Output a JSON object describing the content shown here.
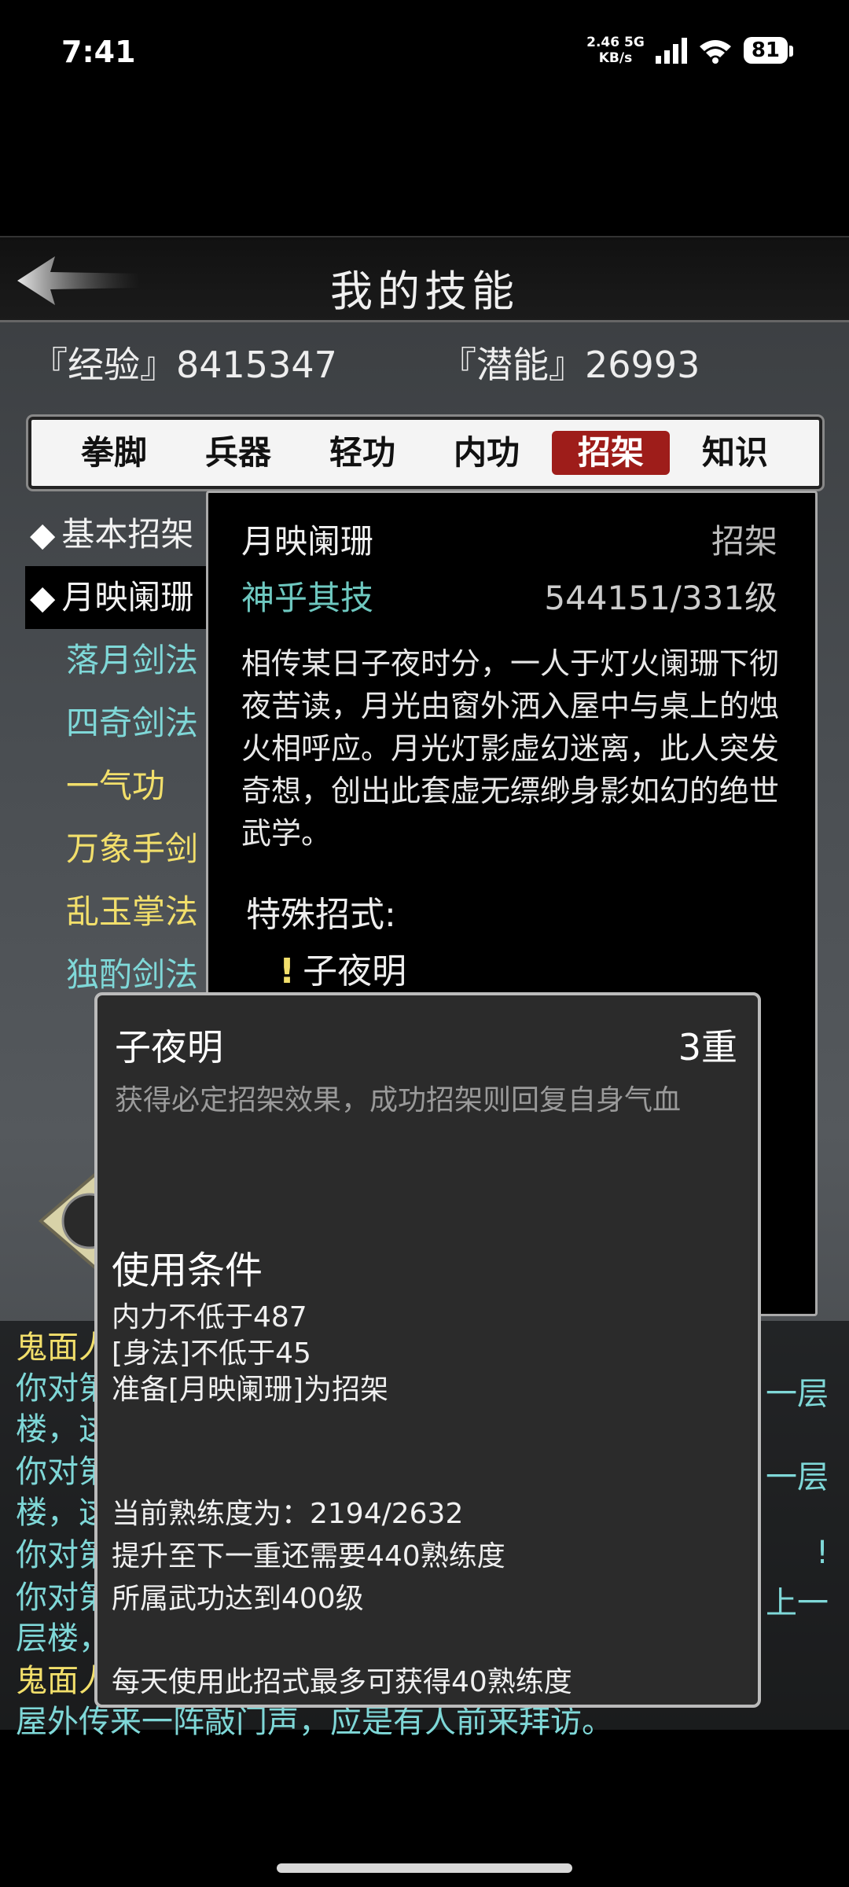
{
  "status_bar": {
    "time": "7:41",
    "net_speed": "2.46",
    "net_unit": "KB/s",
    "network": "5G",
    "battery": "81"
  },
  "header": {
    "title": "我的技能"
  },
  "stats": {
    "experience": "『经验』8415347",
    "potential": "『潜能』26993"
  },
  "tabs": [
    {
      "label": "拳脚"
    },
    {
      "label": "兵器"
    },
    {
      "label": "轻功"
    },
    {
      "label": "内功"
    },
    {
      "label": "招架",
      "active": true
    },
    {
      "label": "知识"
    }
  ],
  "skill_list": [
    {
      "name": "基本招架",
      "color": "#f2f2f2",
      "bullet": "◆"
    },
    {
      "name": "月映阑珊",
      "color": "#f2f2f2",
      "bullet": "◆"
    },
    {
      "name": "落月剑法",
      "color": "#7fd8d8"
    },
    {
      "name": "四奇剑法",
      "color": "#7fd8d8"
    },
    {
      "name": "一气功",
      "color": "#f2df6b"
    },
    {
      "name": "万象手剑",
      "color": "#f2df6b"
    },
    {
      "name": "乱玉掌法",
      "color": "#f2df6b"
    },
    {
      "name": "独酌剑法",
      "color": "#7fd8d8"
    }
  ],
  "detail": {
    "name": "月映阑珊",
    "type": "招架",
    "grade": "神乎其技",
    "level": "544151/331级",
    "description": "相传某日子夜时分，一人于灯火阑珊下彻夜苦读，月光由窗外洒入屋中与桌上的烛火相呼应。月光灯影虚幻迷离，此人突发奇想，创出此套虚无缥缈身影如幻的绝世武学。",
    "special_title": "特殊招式:",
    "special_move": "子夜明",
    "special_mark": "!"
  },
  "log": {
    "lines": [
      {
        "text": "鬼面人",
        "color": "#f2df6b"
      },
      {
        "text": "你对第",
        "color": "#7fd8d8"
      },
      {
        "text": "楼，这",
        "color": "#7fd8d8"
      },
      {
        "text": "你对第",
        "color": "#7fd8d8"
      },
      {
        "text": "楼，这",
        "color": "#7fd8d8"
      },
      {
        "text": "你对第",
        "color": "#7fd8d8"
      },
      {
        "text": "你对第",
        "color": "#7fd8d8"
      },
      {
        "text": "层楼，",
        "color": "#7fd8d8"
      },
      {
        "text": "鬼面人",
        "color": "#f2df6b"
      },
      {
        "text": "屋外传来一阵敲门声，应是有人前来拜访。",
        "color": "#7fd8d8"
      }
    ],
    "right_fragments": [
      "一层",
      "一层",
      "!",
      "上一"
    ]
  },
  "popup": {
    "name": "子夜明",
    "rank": "3重",
    "effect": "获得必定招架效果，成功招架则回复自身气血",
    "conditions_title": "使用条件",
    "conditions": [
      "内力不低于487",
      "[身法]不低于45",
      "准备[月映阑珊]为招架"
    ],
    "progress": [
      "当前熟练度为：2194/2632",
      "提升至下一重还需要440熟练度",
      "所属武功达到400级"
    ],
    "daily_limit": "每天使用此招式最多可获得40熟练度"
  }
}
